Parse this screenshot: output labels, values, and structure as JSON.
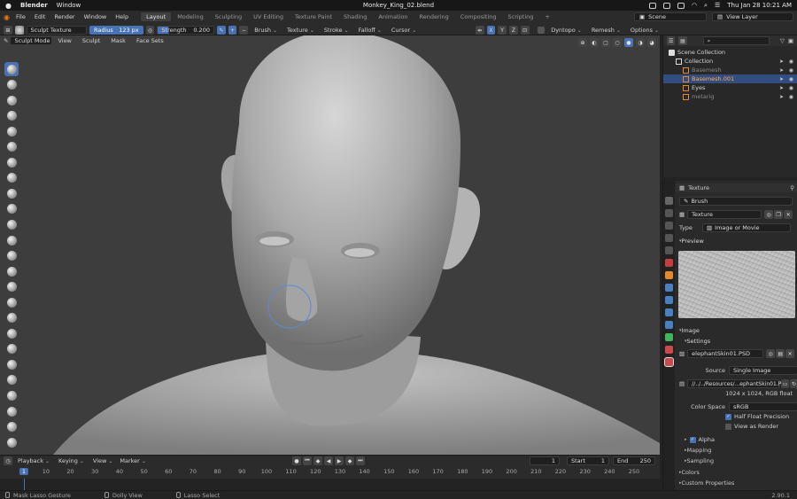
{
  "mac_menubar": {
    "app_name": "Blender",
    "menu_window": "Window",
    "file_title": "Monkey_King_02.blend",
    "clock": "Thu Jan 28  10:21 AM"
  },
  "blender_menu": [
    "File",
    "Edit",
    "Render",
    "Window",
    "Help"
  ],
  "workspaces": [
    {
      "label": "Layout",
      "active": true
    },
    {
      "label": "Modeling",
      "active": false
    },
    {
      "label": "Sculpting",
      "active": false
    },
    {
      "label": "UV Editing",
      "active": false
    },
    {
      "label": "Texture Paint",
      "active": false
    },
    {
      "label": "Shading",
      "active": false
    },
    {
      "label": "Animation",
      "active": false
    },
    {
      "label": "Rendering",
      "active": false
    },
    {
      "label": "Compositing",
      "active": false
    },
    {
      "label": "Scripting",
      "active": false
    }
  ],
  "add_workspace": "+",
  "scene": {
    "scene_name": "Scene",
    "view_layer": "View Layer"
  },
  "tool_settings": {
    "brush_name": "Sculpt Texture",
    "radius_label": "Radius",
    "radius_value": "123 px",
    "strength_label": "Strength",
    "strength_value": "0.200",
    "minus": "−",
    "plus": "+",
    "brush_menu": "Brush",
    "texture_menu": "Texture",
    "stroke_menu": "Stroke",
    "falloff_menu": "Falloff",
    "cursor_menu": "Cursor",
    "axis_x": "X",
    "axis_y": "Y",
    "axis_z": "Z",
    "dyntopo": "Dyntopo",
    "remesh": "Remesh",
    "options": "Options"
  },
  "viewport_header": {
    "mode": "Sculpt Mode",
    "menus": [
      "View",
      "Sculpt",
      "Mask",
      "Face Sets"
    ]
  },
  "sculpt_tools_count": 25,
  "outliner": {
    "title": "Scene Collection",
    "rows": [
      {
        "label": "Collection",
        "indent": 1,
        "selected": false,
        "muted": false
      },
      {
        "label": "Basemesh",
        "indent": 2,
        "selected": false,
        "muted": true
      },
      {
        "label": "Basemesh.001",
        "indent": 2,
        "selected": true,
        "muted": false
      },
      {
        "label": "Eyes",
        "indent": 2,
        "selected": false,
        "muted": false
      },
      {
        "label": "metarig",
        "indent": 2,
        "selected": false,
        "muted": true
      }
    ]
  },
  "properties": {
    "header": "Texture",
    "brush_selector": "Brush",
    "texture_name": "Texture",
    "type_label": "Type",
    "type_value": "Image or Movie",
    "preview_section": "Preview",
    "image_section": "Image",
    "settings_section": "Settings",
    "image_name": "elephantSkin01.PSD",
    "source_label": "Source",
    "source_value": "Single Image",
    "filepath": "//../../Resources/...ephantSkin01.PSD",
    "resolution": "1024 x 1024,  RGB float",
    "color_space_label": "Color Space",
    "color_space_value": "sRGB",
    "half_float": "Half Float Precision",
    "view_as_render": "View as Render",
    "alpha_section": "Alpha",
    "mapping_section": "Mapping",
    "sampling_section": "Sampling",
    "colors_section": "Colors",
    "custom_props_section": "Custom Properties"
  },
  "timeline": {
    "menus": [
      "Playback",
      "Keying",
      "View",
      "Marker"
    ],
    "current_frame": "1",
    "start_label": "Start",
    "start_value": "1",
    "end_label": "End",
    "end_value": "250",
    "ticks": [
      "1",
      "10",
      "20",
      "30",
      "40",
      "50",
      "60",
      "70",
      "80",
      "90",
      "100",
      "110",
      "120",
      "130",
      "140",
      "150",
      "160",
      "170",
      "180",
      "190",
      "200",
      "210",
      "220",
      "230",
      "240",
      "250"
    ]
  },
  "statusbar": {
    "left": "Mask Lasso Gesture",
    "middle": "Dolly View",
    "right": "Lasso Select",
    "version": "2.90.1"
  },
  "colors": {
    "accent": "#4772b3",
    "viewport_bg": "#3d3d3d",
    "panel_bg": "#2a2a2a"
  }
}
